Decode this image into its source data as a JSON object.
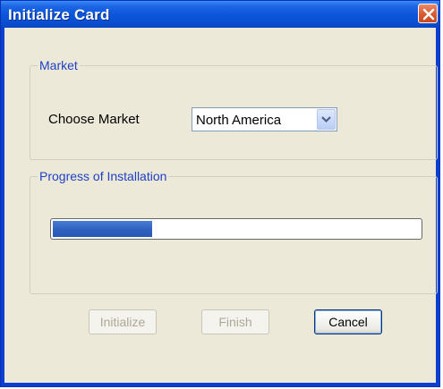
{
  "window": {
    "title": "Initialize Card"
  },
  "market": {
    "legend": "Market",
    "choose_label": "Choose Market",
    "selected": "North America"
  },
  "progress": {
    "legend": "Progress of Installation",
    "fraction": 0.27
  },
  "buttons": {
    "initialize": {
      "label": "Initialize",
      "enabled": false
    },
    "finish": {
      "label": "Finish",
      "enabled": false
    },
    "cancel": {
      "label": "Cancel",
      "enabled": true
    }
  },
  "icons": {
    "close": "close-icon",
    "dropdown": "chevron-down-icon"
  },
  "colors": {
    "titlebar": "#0b56db",
    "client": "#ece9d8",
    "legend_text": "#1f40c7",
    "progress_fill": "#2f63c1",
    "close_button": "#d95a2f"
  }
}
